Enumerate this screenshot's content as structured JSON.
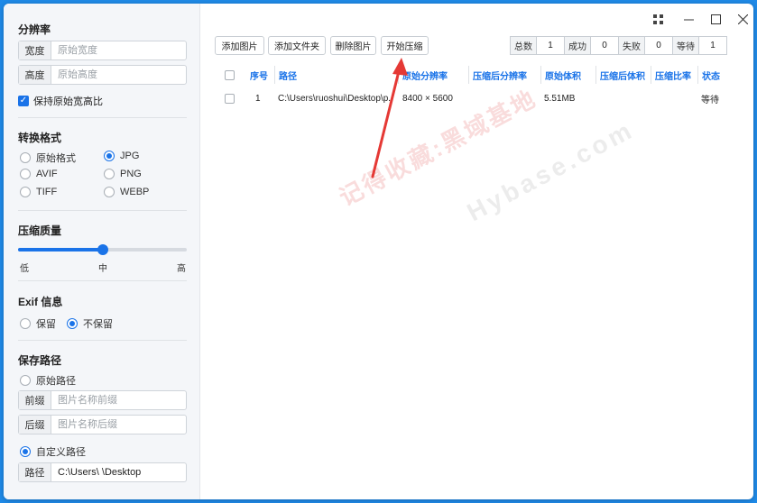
{
  "sidebar": {
    "resolution": {
      "title": "分辨率",
      "width_label": "宽度",
      "width_placeholder": "原始宽度",
      "height_label": "高度",
      "height_placeholder": "原始高度",
      "keep_ratio_label": "保持原始宽高比",
      "keep_ratio_checked": true
    },
    "format": {
      "title": "转换格式",
      "options": [
        "原始格式",
        "JPG",
        "AVIF",
        "PNG",
        "TIFF",
        "WEBP"
      ],
      "selected": "JPG"
    },
    "quality": {
      "title": "压缩质量",
      "low": "低",
      "mid": "中",
      "high": "高",
      "value_fraction": 0.5
    },
    "exif": {
      "title": "Exif 信息",
      "keep": "保留",
      "discard": "不保留",
      "selected": "不保留"
    },
    "save": {
      "title": "保存路径",
      "original_path": "原始路径",
      "prefix_label": "前缀",
      "prefix_placeholder": "图片名称前缀",
      "suffix_label": "后缀",
      "suffix_placeholder": "图片名称后缀",
      "custom_path": "自定义路径",
      "path_label": "路径",
      "path_value": "C:\\Users\\ \\Desktop",
      "selected": "自定义路径"
    }
  },
  "toolbar": {
    "add_image": "添加图片",
    "add_folder": "添加文件夹",
    "delete_image": "删除图片",
    "start_compress": "开始压缩"
  },
  "stats": [
    {
      "label": "总数",
      "value": "1"
    },
    {
      "label": "成功",
      "value": "0"
    },
    {
      "label": "失败",
      "value": "0"
    },
    {
      "label": "等待",
      "value": "1"
    }
  ],
  "table": {
    "headers": [
      "序号",
      "路径",
      "原始分辨率",
      "压缩后分辨率",
      "原始体积",
      "压缩后体积",
      "压缩比率",
      "状态"
    ],
    "rows": [
      {
        "index": "1",
        "path": "C:\\Users\\ruoshui\\Desktop\\p...",
        "orig_res": "8400 × 5600",
        "new_res": "",
        "orig_size": "5.51MB",
        "new_size": "",
        "ratio": "",
        "status": "等待"
      }
    ]
  },
  "watermark": {
    "red": "记得收藏:黑域基地",
    "gray": "Hybase.com"
  },
  "colors": {
    "accent": "#1a73e8",
    "desktop": "#1f8ae8",
    "arrow": "#e53935"
  },
  "icons": {
    "grid": "grid-icon",
    "minimize": "minimize-icon",
    "maximize": "maximize-icon",
    "close": "close-icon"
  }
}
